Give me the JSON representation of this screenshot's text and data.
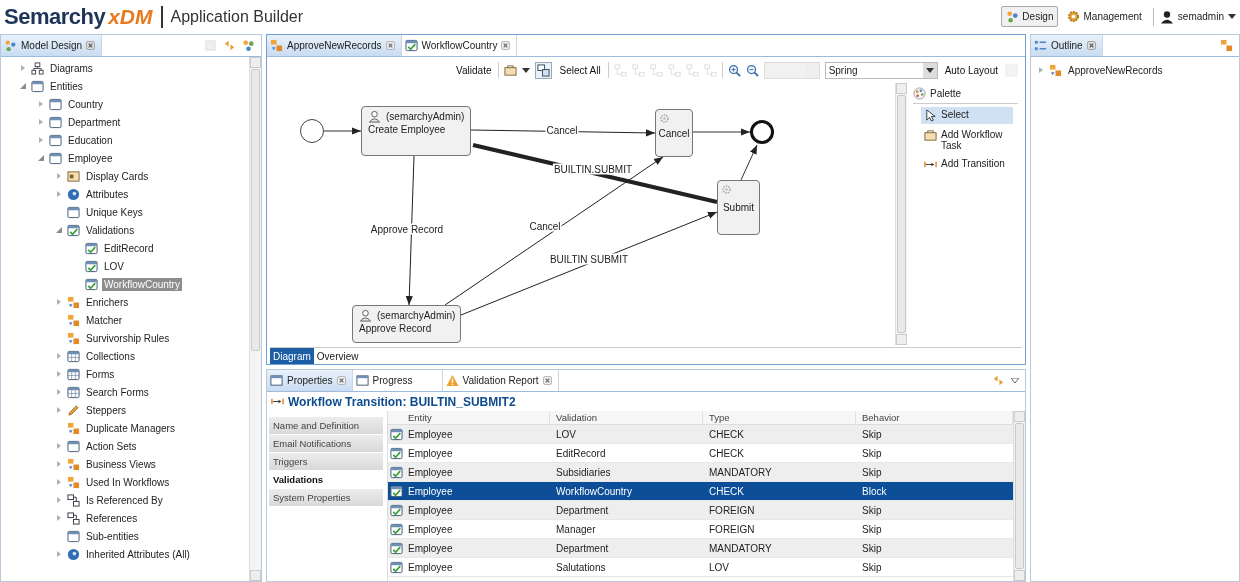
{
  "header": {
    "logo": {
      "name": "Semarchy",
      "product": "xDM"
    },
    "app_title": "Application Builder",
    "perspectives": [
      {
        "label": "Design",
        "selected": true
      },
      {
        "label": "Management",
        "selected": false
      }
    ],
    "user": "semadmin"
  },
  "model_design": {
    "tab": "Model Design",
    "tree": [
      {
        "label": "Diagrams",
        "kind": "diagram",
        "expanded": false,
        "selected": false
      },
      {
        "label": "Entities",
        "kind": "entity",
        "expanded": true,
        "selected": false,
        "children": [
          {
            "label": "Country",
            "kind": "entity",
            "expanded": false,
            "selected": false
          },
          {
            "label": "Department",
            "kind": "entity",
            "expanded": false,
            "selected": false
          },
          {
            "label": "Education",
            "kind": "entity",
            "expanded": false,
            "selected": false
          },
          {
            "label": "Employee",
            "kind": "entity",
            "expanded": true,
            "selected": false,
            "children": [
              {
                "label": "Display Cards",
                "kind": "card",
                "expanded": false,
                "selected": false
              },
              {
                "label": "Attributes",
                "kind": "attribute",
                "expanded": false,
                "selected": false
              },
              {
                "label": "Unique Keys",
                "kind": "entity",
                "selected": false
              },
              {
                "label": "Validations",
                "kind": "validation",
                "expanded": true,
                "selected": false,
                "children": [
                  {
                    "label": "EditRecord",
                    "kind": "validation",
                    "selected": false
                  },
                  {
                    "label": "LOV",
                    "kind": "validation",
                    "selected": false
                  },
                  {
                    "label": "WorkflowCountry",
                    "kind": "validation",
                    "selected": true
                  }
                ]
              },
              {
                "label": "Enrichers",
                "kind": "rule",
                "expanded": false,
                "selected": false
              },
              {
                "label": "Matcher",
                "kind": "rule",
                "selected": false
              },
              {
                "label": "Survivorship Rules",
                "kind": "rule",
                "selected": false
              },
              {
                "label": "Collections",
                "kind": "grid",
                "expanded": false,
                "selected": false
              },
              {
                "label": "Forms",
                "kind": "grid",
                "expanded": false,
                "selected": false
              },
              {
                "label": "Search Forms",
                "kind": "grid",
                "expanded": false,
                "selected": false
              },
              {
                "label": "Steppers",
                "kind": "pencil",
                "expanded": false,
                "selected": false
              },
              {
                "label": "Duplicate Managers",
                "kind": "rule",
                "selected": false
              },
              {
                "label": "Action Sets",
                "kind": "entity",
                "expanded": false,
                "selected": false
              },
              {
                "label": "Business Views",
                "kind": "rule",
                "expanded": false,
                "selected": false
              },
              {
                "label": "Used In Workflows",
                "kind": "rule",
                "expanded": false,
                "selected": false
              },
              {
                "label": "Is Referenced By",
                "kind": "reference",
                "expanded": false,
                "selected": false
              },
              {
                "label": "References",
                "kind": "reference",
                "expanded": false,
                "selected": false
              },
              {
                "label": "Sub-entities",
                "kind": "entity",
                "selected": false
              },
              {
                "label": "Inherited Attributes (All)",
                "kind": "attribute",
                "expanded": false,
                "selected": false
              }
            ]
          }
        ]
      }
    ]
  },
  "editor": {
    "tabs": [
      {
        "label": "ApproveNewRecords",
        "kind": "workflow",
        "selected": true
      },
      {
        "label": "WorkflowCountry",
        "kind": "validation",
        "selected": false
      }
    ],
    "toolbar": {
      "validate": "Validate",
      "select_all": "Select All",
      "layout": "Spring",
      "auto_layout": "Auto Layout"
    },
    "nodes": [
      {
        "kind": "start"
      },
      {
        "kind": "task",
        "performer": "(semarchyAdmin)",
        "name": "Create Employee"
      },
      {
        "kind": "step",
        "name": "Cancel"
      },
      {
        "kind": "end"
      },
      {
        "kind": "step",
        "name": "Submit"
      },
      {
        "kind": "task",
        "performer": "(semarchyAdmin)",
        "name": "Approve Record"
      }
    ],
    "transitions": [
      {
        "label": "Cancel",
        "highlighted": false
      },
      {
        "label": "BUILTIN.SUBMIT",
        "highlighted": true
      },
      {
        "label": "Approve Record",
        "highlighted": false
      },
      {
        "label": "Cancel",
        "highlighted": false
      },
      {
        "label": "BUILTIN SUBMIT",
        "highlighted": false
      }
    ],
    "palette": {
      "title": "Palette",
      "items": [
        {
          "label": "Select",
          "kind": "pointer",
          "selected": true
        },
        {
          "label": "Add Workflow Task",
          "kind": "task",
          "selected": false
        },
        {
          "label": "Add Transition",
          "kind": "transition",
          "selected": false
        }
      ]
    },
    "view_tabs": [
      {
        "label": "Diagram",
        "selected": true
      },
      {
        "label": "Overview",
        "selected": false
      }
    ]
  },
  "properties": {
    "tabs": [
      {
        "label": "Properties",
        "kind": "window",
        "selected": true
      },
      {
        "label": "Progress",
        "kind": "window",
        "selected": false
      },
      {
        "label": "Validation Report",
        "kind": "warning",
        "selected": false
      }
    ],
    "title": "Workflow Transition: BUILTIN_SUBMIT2",
    "sections": [
      {
        "label": "Name and Definition",
        "selected": false
      },
      {
        "label": "Email Notifications",
        "selected": false
      },
      {
        "label": "Triggers",
        "selected": false
      },
      {
        "label": "Validations",
        "selected": true
      },
      {
        "label": "System Properties",
        "selected": false
      }
    ],
    "table": {
      "columns": [
        "Entity",
        "Validation",
        "Type",
        "Behavior"
      ],
      "rows": [
        {
          "cells": [
            "Employee",
            "LOV",
            "CHECK",
            "Skip"
          ],
          "selected": false
        },
        {
          "cells": [
            "Employee",
            "EditRecord",
            "CHECK",
            "Skip"
          ],
          "selected": false
        },
        {
          "cells": [
            "Employee",
            "Subsidiaries",
            "MANDATORY",
            "Skip"
          ],
          "selected": false
        },
        {
          "cells": [
            "Employee",
            "WorkflowCountry",
            "CHECK",
            "Block"
          ],
          "selected": true
        },
        {
          "cells": [
            "Employee",
            "Department",
            "FOREIGN",
            "Skip"
          ],
          "selected": false
        },
        {
          "cells": [
            "Employee",
            "Manager",
            "FOREIGN",
            "Skip"
          ],
          "selected": false
        },
        {
          "cells": [
            "Employee",
            "Department",
            "MANDATORY",
            "Skip"
          ],
          "selected": false
        },
        {
          "cells": [
            "Employee",
            "Salutations",
            "LOV",
            "Skip"
          ],
          "selected": false
        }
      ]
    }
  },
  "outline": {
    "tab": "Outline",
    "tree": [
      {
        "label": "ApproveNewRecords",
        "expanded": false,
        "selected": false
      }
    ]
  }
}
